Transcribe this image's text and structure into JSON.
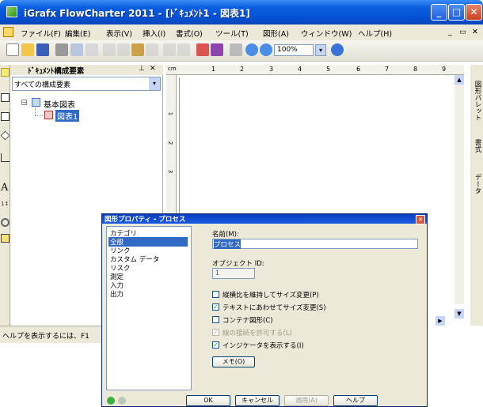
{
  "window": {
    "title": "iGrafx FlowCharter 2011 - [ﾄﾞｷｭﾒﾝﾄ1 - 図表1]"
  },
  "menu": [
    "ファイル(F)",
    "編集(E)",
    "表示(V)",
    "挿入(I)",
    "書式(O)",
    "ツール(T)",
    "図形(A)",
    "ウィンドウ(W)",
    "ヘルプ(H)"
  ],
  "toolbar": {
    "zoom": "100%"
  },
  "doc_panel": {
    "title": "ﾄﾞｷｭﾒﾝﾄ構成要素",
    "filter": "すべての構成要素",
    "tree_root": "基本図表",
    "tree_child": "図表1"
  },
  "ruler": {
    "numbers": [
      "1",
      "2",
      "3",
      "4",
      "5",
      "6",
      "7",
      "8",
      "9"
    ],
    "unit": "cm"
  },
  "right_tabs": [
    "図形パレット",
    "書式",
    "データ"
  ],
  "statusbar": {
    "text": "ヘルプを表示するには、F1"
  },
  "dialog": {
    "title": "図形プロパティ - プロセス",
    "categories_label": "カテゴリ",
    "categories": [
      "全般",
      "リンク",
      "カスタム データ",
      "リスク",
      "測定",
      "入力",
      "出力"
    ],
    "name_label": "名前(M):",
    "name_value": "プロセス",
    "object_id_label": "オブジェクト ID:",
    "object_id_value": "1",
    "checkboxes": [
      {
        "label": "縦横比を維持してサイズ変更(P)",
        "checked": false
      },
      {
        "label": "テキストにあわせてサイズ変更(S)",
        "checked": true
      },
      {
        "label": "コンテナ図形(C)",
        "checked": false
      },
      {
        "label": "線の接続を許可する(L)",
        "checked": true,
        "disabled": true
      },
      {
        "label": "インジケータを表示する(I)",
        "checked": true
      }
    ],
    "memo_button": "メモ(O)",
    "ok": "OK",
    "cancel": "キャンセル",
    "apply": "適用(A)",
    "help": "ヘルプ"
  }
}
